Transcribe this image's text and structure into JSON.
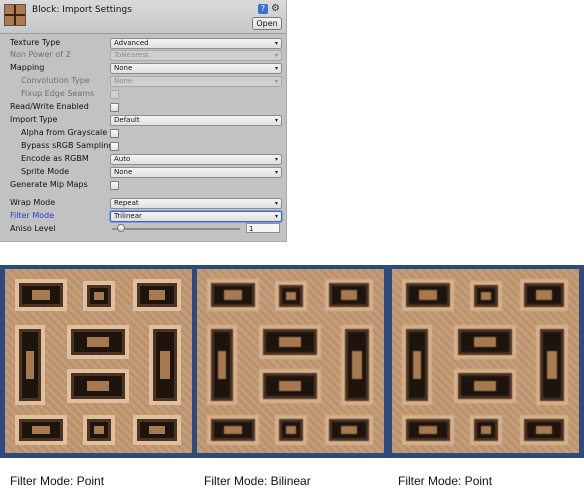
{
  "inspector": {
    "title": "Block: Import Settings",
    "open_label": "Open",
    "help_icon_glyph": "?",
    "gear_icon_glyph": "⚙",
    "rows": [
      {
        "label": "Texture Type",
        "value": "Advanced"
      },
      {
        "label": "Non Power of 2",
        "value": "ToNearest"
      },
      {
        "label": "Mapping",
        "value": "None"
      },
      {
        "label": "Convolution Type",
        "value": "None"
      },
      {
        "label": "Fixup Edge Seams"
      },
      {
        "label": "Read/Write Enabled"
      },
      {
        "label": "Import Type",
        "value": "Default"
      },
      {
        "label": "Alpha from Grayscale"
      },
      {
        "label": "Bypass sRGB Sampling"
      },
      {
        "label": "Encode as RGBM",
        "value": "Auto"
      },
      {
        "label": "Sprite Mode",
        "value": "None"
      },
      {
        "label": "Generate Mip Maps"
      },
      {
        "label": "Wrap Mode",
        "value": "Repeat"
      },
      {
        "label": "Filter Mode",
        "value": "Trilinear"
      },
      {
        "label": "Aniso Level",
        "value": "1"
      }
    ],
    "aniso_level": 1
  },
  "captions": [
    "Filter Mode: Point",
    "Filter Mode: Bilinear",
    "Filter Mode: Point"
  ],
  "colors": {
    "selected_label": "#1f3fd0",
    "strip_background": "#2d4a7d"
  }
}
